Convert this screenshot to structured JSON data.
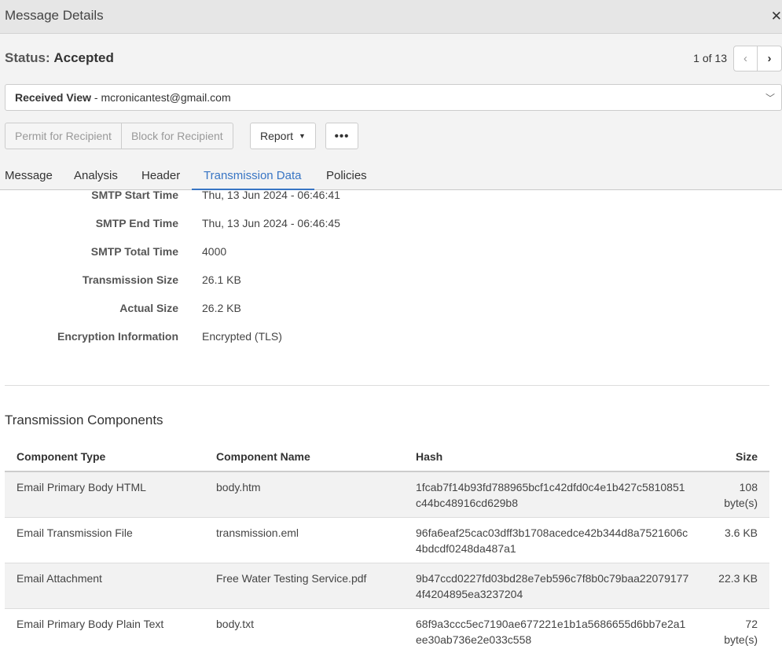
{
  "window": {
    "title": "Message Details"
  },
  "status": {
    "label": "Status:",
    "value": "Accepted"
  },
  "pager": {
    "text": "1 of 13"
  },
  "view_select": {
    "label": "Received View",
    "separator": " - ",
    "email": "mcronicantest@gmail.com"
  },
  "actions": {
    "permit": "Permit for Recipient",
    "block": "Block for Recipient",
    "report": "Report",
    "more": "•••"
  },
  "tabs": [
    {
      "label": "Message"
    },
    {
      "label": "Analysis"
    },
    {
      "label": "Header"
    },
    {
      "label": "Transmission Data",
      "active": true
    },
    {
      "label": "Policies"
    }
  ],
  "properties": [
    {
      "label": "SMTP Start Time",
      "value": "Thu, 13 Jun 2024 - 06:46:41"
    },
    {
      "label": "SMTP End Time",
      "value": "Thu, 13 Jun 2024 - 06:46:45"
    },
    {
      "label": "SMTP Total Time",
      "value": "4000"
    },
    {
      "label": "Transmission Size",
      "value": "26.1 KB"
    },
    {
      "label": "Actual Size",
      "value": "26.2 KB"
    },
    {
      "label": "Encryption Information",
      "value": "Encrypted (TLS)"
    }
  ],
  "components": {
    "title": "Transmission Components",
    "columns": [
      "Component Type",
      "Component Name",
      "Hash",
      "Size"
    ],
    "rows": [
      {
        "type": "Email Primary Body HTML",
        "name": "body.htm",
        "hash": "1fcab7f14b93fd788965bcf1c42dfd0c4e1b427c5810851c44bc48916cd629b8",
        "size": "108 byte(s)"
      },
      {
        "type": "Email Transmission File",
        "name": "transmission.eml",
        "hash": "96fa6eaf25cac03dff3b1708acedce42b344d8a7521606c4bdcdf0248da487a1",
        "size": "3.6 KB"
      },
      {
        "type": "Email Attachment",
        "name": "Free Water Testing Service.pdf",
        "hash": "9b47ccd0227fd03bd28e7eb596c7f8b0c79baa220791774f4204895ea3237204",
        "size": "22.3 KB"
      },
      {
        "type": "Email Primary Body Plain Text",
        "name": "body.txt",
        "hash": "68f9a3ccc5ec7190ae677221e1b1a5686655d6bb7e2a1ee30ab736e2e033c558",
        "size": "72 byte(s)"
      }
    ]
  },
  "icons": {
    "close": "close-icon",
    "prev": "chevron-left-icon",
    "next": "chevron-right-icon",
    "dropdown": "chevron-down-icon",
    "caret": "caret-down-icon"
  },
  "colors": {
    "accent": "#3875c4",
    "titlebar": "#e6e6e6"
  }
}
